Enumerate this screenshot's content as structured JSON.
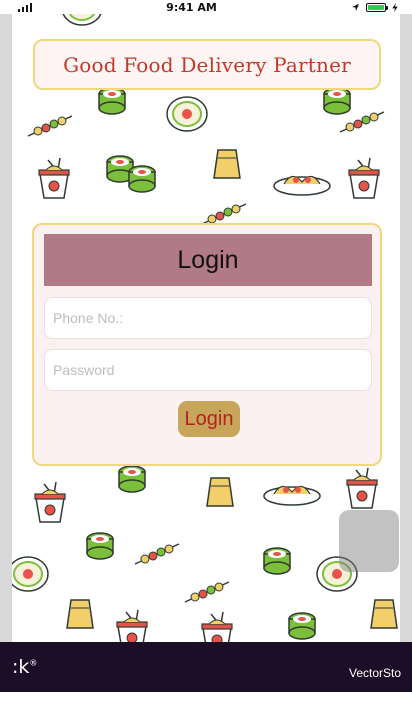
{
  "status_bar": {
    "time": "9:41 AM",
    "battery_level": 1.0,
    "icons": [
      "signal-icon",
      "wifi-icon",
      "location-arrow-icon",
      "battery-icon",
      "charging-bolt-icon"
    ]
  },
  "header": {
    "title": "Good Food Delivery Partner"
  },
  "login_card": {
    "title": "Login",
    "phone_placeholder": "Phone No.:",
    "phone_value": "",
    "password_placeholder": "Password",
    "password_value": "",
    "submit_label": "Login"
  },
  "watermark": {
    "left_text": ":k",
    "left_mark": "®",
    "right_text": "VectorSto"
  },
  "colors": {
    "banner_text": "#c0392b",
    "banner_border": "#f0d77b",
    "card_header": "#b17a85",
    "button_bg": "#c7a65b",
    "button_text": "#b3241f",
    "stock_bar": "#1c0e26"
  },
  "background_pattern_icons": [
    "sushi-roll-icon",
    "noodle-box-icon",
    "kebab-skewer-icon",
    "noodle-bowl-icon",
    "paper-bag-icon",
    "sushi-plate-icon",
    "chopsticks-icon"
  ]
}
